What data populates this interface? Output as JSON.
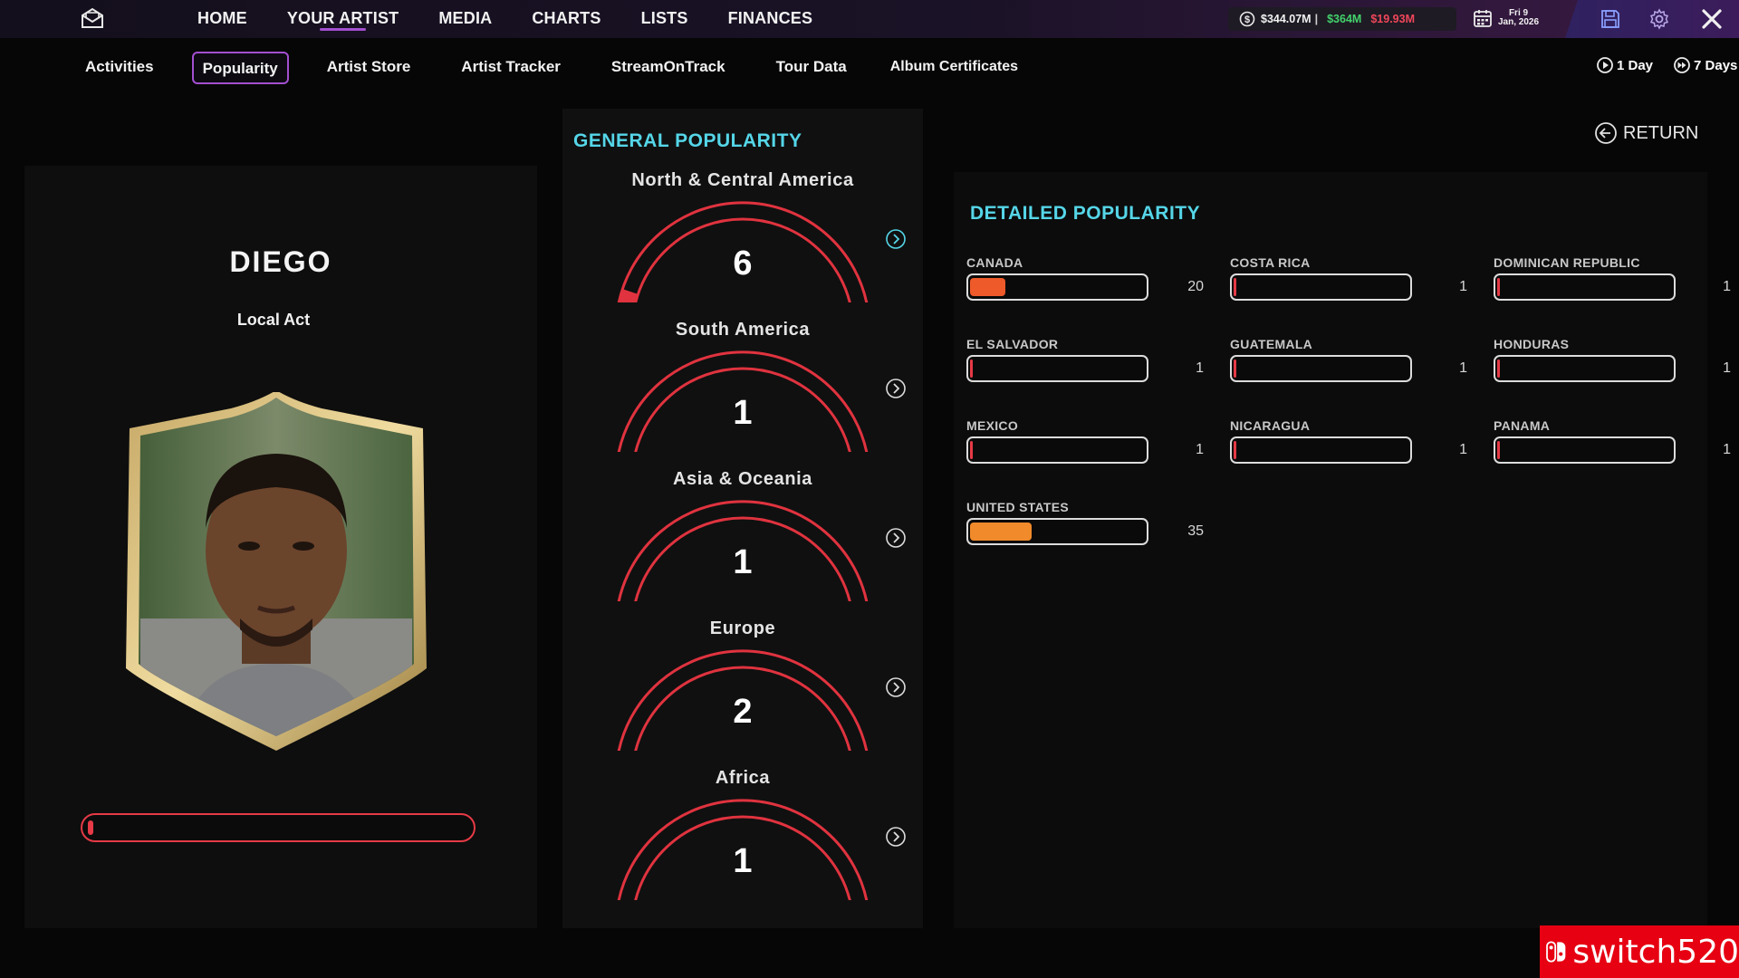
{
  "topbar": {
    "nav": [
      "HOME",
      "YOUR ARTIST",
      "MEDIA",
      "CHARTS",
      "LISTS",
      "FINANCES"
    ],
    "active_nav": "YOUR ARTIST",
    "money_total": "$344.07M",
    "money_income": "$364M",
    "money_expense": "$19.93M",
    "date_day": "Fri 9",
    "date_month_year": "Jan, 2026",
    "icons": [
      "mail-icon",
      "coin-icon",
      "calendar-icon",
      "save-icon",
      "gear-icon",
      "close-icon"
    ]
  },
  "subnav": {
    "tabs": [
      "Activities",
      "Popularity",
      "Artist Store",
      "Artist Tracker",
      "StreamOnTrack",
      "Tour Data",
      "Album Certificates"
    ],
    "active_tab": "Popularity",
    "timer_1": "1 Day",
    "timer_7": "7 Days"
  },
  "artist": {
    "name": "DIEGO",
    "tier": "Local Act",
    "progress": 0.01,
    "accent": "#e63a46"
  },
  "general": {
    "title": "GENERAL POPULARITY",
    "regions": [
      {
        "name": "North & Central America",
        "value": "6",
        "level": 0.06
      },
      {
        "name": "South America",
        "value": "1",
        "level": 0.0
      },
      {
        "name": "Asia & Oceania",
        "value": "1",
        "level": 0.0
      },
      {
        "name": "Europe",
        "value": "2",
        "level": 0.0
      },
      {
        "name": "Africa",
        "value": "1",
        "level": 0.0
      }
    ]
  },
  "return_label": "RETURN",
  "detailed": {
    "title": "DETAILED POPULARITY",
    "countries": [
      {
        "name": "CANADA",
        "value": "20",
        "level": 0.2,
        "color": "#ee5a2a"
      },
      {
        "name": "COSTA RICA",
        "value": "1",
        "level": 0.01,
        "color": "#e63a46"
      },
      {
        "name": "DOMINICAN REPUBLIC",
        "value": "1",
        "level": 0.01,
        "color": "#e63a46"
      },
      {
        "name": "EL SALVADOR",
        "value": "1",
        "level": 0.01,
        "color": "#e63a46"
      },
      {
        "name": "GUATEMALA",
        "value": "1",
        "level": 0.01,
        "color": "#e63a46"
      },
      {
        "name": "HONDURAS",
        "value": "1",
        "level": 0.01,
        "color": "#e63a46"
      },
      {
        "name": "MEXICO",
        "value": "1",
        "level": 0.01,
        "color": "#e63a46"
      },
      {
        "name": "NICARAGUA",
        "value": "1",
        "level": 0.01,
        "color": "#e63a46"
      },
      {
        "name": "PANAMA",
        "value": "1",
        "level": 0.01,
        "color": "#e63a46"
      },
      {
        "name": "UNITED STATES",
        "value": "35",
        "level": 0.35,
        "color": "#f08a2a"
      }
    ]
  },
  "watermark": "switch520"
}
